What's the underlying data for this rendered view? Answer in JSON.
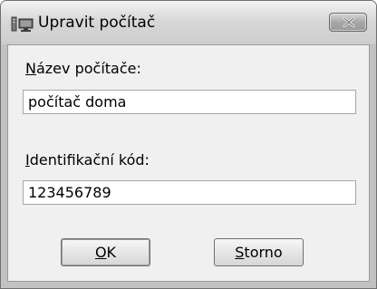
{
  "window": {
    "title": "Upravit počítač",
    "icon": "computer-icon",
    "close_icon": "close-icon"
  },
  "form": {
    "name_label_accel": "N",
    "name_label_rest": "ázev počítače:",
    "name_value": "počítač doma",
    "code_label_accel": "I",
    "code_label_rest": "dentifikační kód:",
    "code_value": "123456789"
  },
  "buttons": {
    "ok_accel": "O",
    "ok_rest": "K",
    "cancel_accel": "S",
    "cancel_rest": "torno"
  }
}
